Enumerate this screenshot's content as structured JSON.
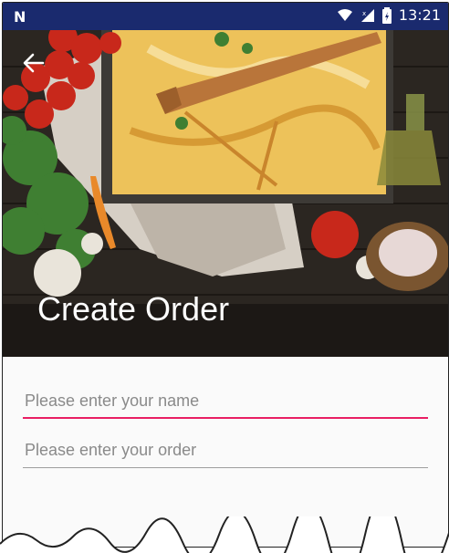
{
  "status_bar": {
    "time": "13:21",
    "notification": "N"
  },
  "header": {
    "title": "Create Order"
  },
  "form": {
    "name_field": {
      "placeholder": "Please enter your name",
      "value": ""
    },
    "order_field": {
      "placeholder": "Please enter your order",
      "value": ""
    }
  },
  "colors": {
    "status_bar": "#1a2a6e",
    "accent": "#e91e63",
    "divider": "#9e9e9e"
  }
}
